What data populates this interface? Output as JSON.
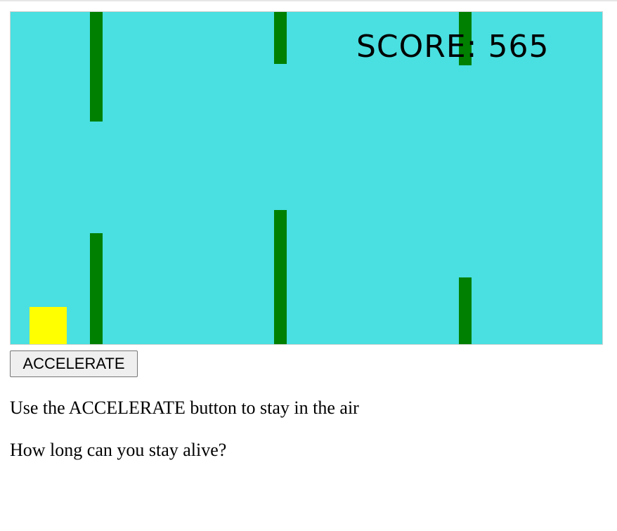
{
  "game": {
    "canvas_color": "#4adfe0",
    "obstacle_color": "#008000",
    "player_color": "#ffff00",
    "score_label": "SCORE",
    "score_value": 565
  },
  "controls": {
    "accelerate_label": "ACCELERATE"
  },
  "instructions": [
    "Use the ACCELERATE button to stay in the air",
    "How long can you stay alive?"
  ]
}
